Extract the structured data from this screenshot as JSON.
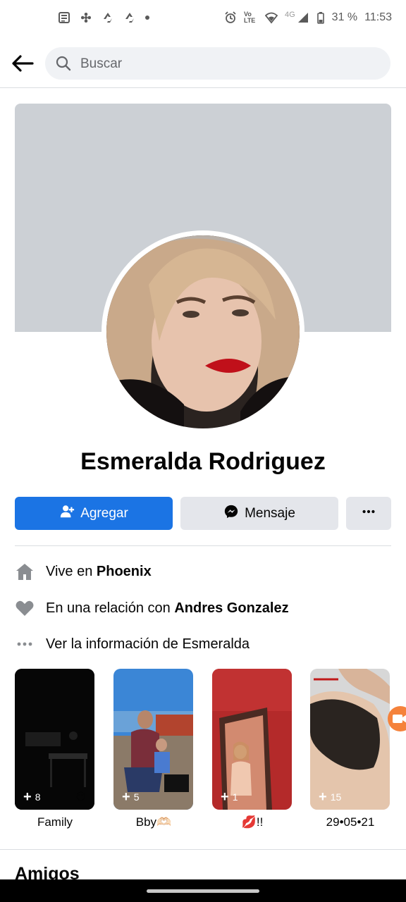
{
  "status_bar": {
    "battery": "31 %",
    "time": "11:53",
    "network": "4G",
    "volte": "Vo LTE",
    "left_icons": [
      "news-icon",
      "fan-icon",
      "recycle-icon",
      "recycle-icon",
      "dot-icon"
    ],
    "right_icons": [
      "alarm-icon",
      "volte-icon",
      "wifi-icon",
      "signal-icon",
      "battery-icon"
    ]
  },
  "header": {
    "search_placeholder": "Buscar"
  },
  "profile": {
    "name": "Esmeralda Rodriguez",
    "cover_color": "#ccd0d5"
  },
  "actions": {
    "add_label": "Agregar",
    "message_label": "Mensaje",
    "accent": "#1b74e4"
  },
  "info": {
    "lives_prefix": "Vive en ",
    "lives_city": "Phoenix",
    "relationship_prefix": "En una relación con ",
    "relationship_partner": "Andres Gonzalez",
    "see_info": "Ver la información de Esmeralda"
  },
  "highlights": [
    {
      "count": "8",
      "label": "Family"
    },
    {
      "count": "5",
      "label": "Bby🫶🏻"
    },
    {
      "count": "1",
      "label": "💋!!"
    },
    {
      "count": "15",
      "label": "29•05•21"
    }
  ],
  "sections": {
    "friends_title": "Amigos"
  }
}
